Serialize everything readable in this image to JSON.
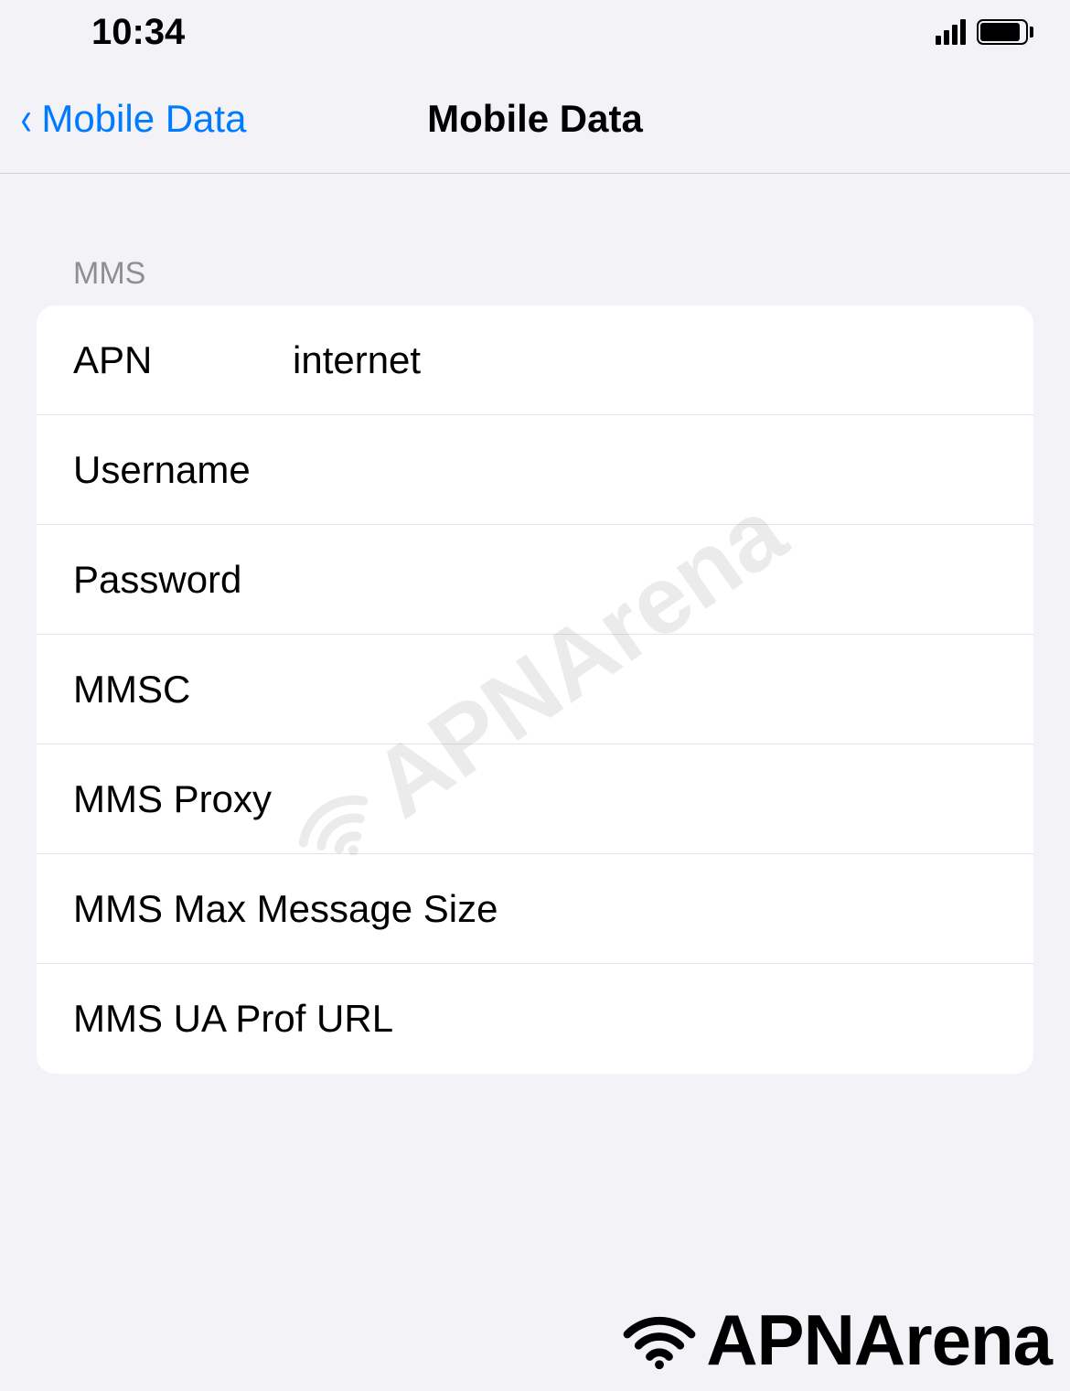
{
  "status_bar": {
    "time": "10:34"
  },
  "nav": {
    "back_label": "Mobile Data",
    "title": "Mobile Data"
  },
  "section_header": "MMS",
  "fields": {
    "apn": {
      "label": "APN",
      "value": "internet"
    },
    "username": {
      "label": "Username",
      "value": ""
    },
    "password": {
      "label": "Password",
      "value": ""
    },
    "mmsc": {
      "label": "MMSC",
      "value": ""
    },
    "mms_proxy": {
      "label": "MMS Proxy",
      "value": ""
    },
    "mms_max": {
      "label": "MMS Max Message Size",
      "value": ""
    },
    "mms_ua": {
      "label": "MMS UA Prof URL",
      "value": ""
    }
  },
  "watermark": "APNArena",
  "brand": "APNArena"
}
